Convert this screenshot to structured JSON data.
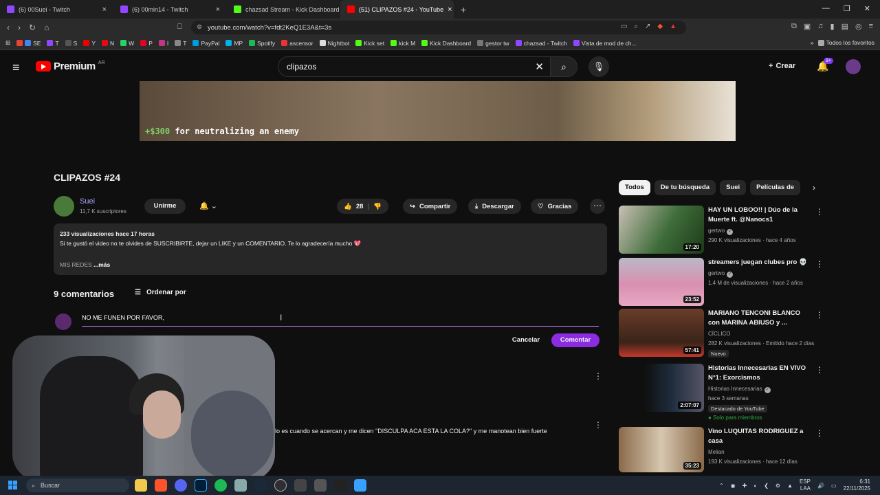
{
  "browser": {
    "tabs": [
      {
        "label": "(6) 00Suei - Twitch",
        "color": "#9146ff"
      },
      {
        "label": "(6) 00min14 - Twitch",
        "color": "#9146ff"
      },
      {
        "label": "chazsad Stream - Kick Dashboard",
        "color": "#53fc18"
      },
      {
        "label": "(51) CLIPAZOS #24 - YouTube",
        "color": "#ff0000"
      }
    ],
    "url": "youtube.com/watch?v=fdt2KeQ1E3A&t=3s",
    "bookmarks": [
      "SE",
      "T",
      "S",
      "Y",
      "N",
      "W",
      "P",
      "I",
      "T",
      "PayPal",
      "MP",
      "Spotify",
      "ascensor",
      "Nightbot",
      "Kick set",
      "kick M",
      "Kick Dashboard",
      "gestor tw",
      "chazsad - Twitch",
      "Vista de mod de ch..."
    ],
    "all_bookmarks": "Todos los favoritos"
  },
  "yt": {
    "brand": "Premium",
    "region": "AR",
    "search_value": "clipazos",
    "create_label": "Crear",
    "notif_count": "9+"
  },
  "video": {
    "overlay_amount": "+$300",
    "overlay_text": "for neutralizing an enemy",
    "title": "CLIPAZOS #24",
    "channel": "Suei",
    "subs": "11,7 K suscriptores",
    "join_label": "Unirme",
    "likes": "28",
    "share_label": "Compartir",
    "download_label": "Descargar",
    "thanks_label": "Gracias"
  },
  "description": {
    "meta": "233 visualizaciones  hace 17 horas",
    "text": "Si te gustó el video no te olvides de SUSCRIBIRTE, dejar un LIKE y un COMENTARIO. Te lo agradecería mucho",
    "heart": "💖",
    "links": "MIS REDES",
    "more": "...más"
  },
  "comments": {
    "count": "9 comentarios",
    "sort_label": "Ordenar por",
    "input_value": "NO ME FUNEN POR FAVOR,",
    "cancel_label": "Cancelar",
    "submit_label": "Comentar",
    "visible_comment": "lo es cuando se acercan y me dicen \"DISCULPA ACA ESTA LA COLA?\" y me manotean bien fuerte"
  },
  "chips": [
    "Todos",
    "De tu búsqueda",
    "Suei",
    "Películas de"
  ],
  "recommended": [
    {
      "title": "HAY UN LOBOO!! | Dúo de la Muerte ft. @Nanocs1",
      "channel": "gertwo",
      "verified": true,
      "meta": "290 K visualizaciones · hace 4 años",
      "duration": "17:20",
      "thumb": "#3f6d3a"
    },
    {
      "title": "streamers juegan clubes pro 💀",
      "channel": "gertwo",
      "verified": true,
      "meta": "1,4 M de visualizaciones · hace 2 años",
      "duration": "23:52",
      "thumb": "#d98fb0"
    },
    {
      "title": "MARIANO TENCONI BLANCO con MARINA ABIUSO y ...",
      "channel": "CÍCLICO",
      "verified": false,
      "meta": "282 K visualizaciones · Emitido hace 2 días",
      "duration": "57:41",
      "badge": "Nuevo",
      "thumb": "#6b3c2a"
    },
    {
      "title": "Historias Innecesarias EN VIVO N°1: Exorcismos",
      "channel": "Historias Innecesarias",
      "verified": true,
      "meta": "hace 3 semanas",
      "duration": "2:07:07",
      "badge": "Destacado de YouTube",
      "extra": "Solo para miembros",
      "thumb": "#1d2a3a"
    },
    {
      "title": "Vino LUQUITAS RODRIGUEZ a casa",
      "channel": "Melian",
      "verified": false,
      "meta": "193 K visualizaciones · hace 12 días",
      "duration": "35:23",
      "thumb": "#8a6a4a"
    }
  ],
  "taskbar": {
    "search_label": "Buscar",
    "lang_top": "ESP",
    "lang_bottom": "LAA",
    "time": "6:31",
    "date": "22/11/2025"
  }
}
